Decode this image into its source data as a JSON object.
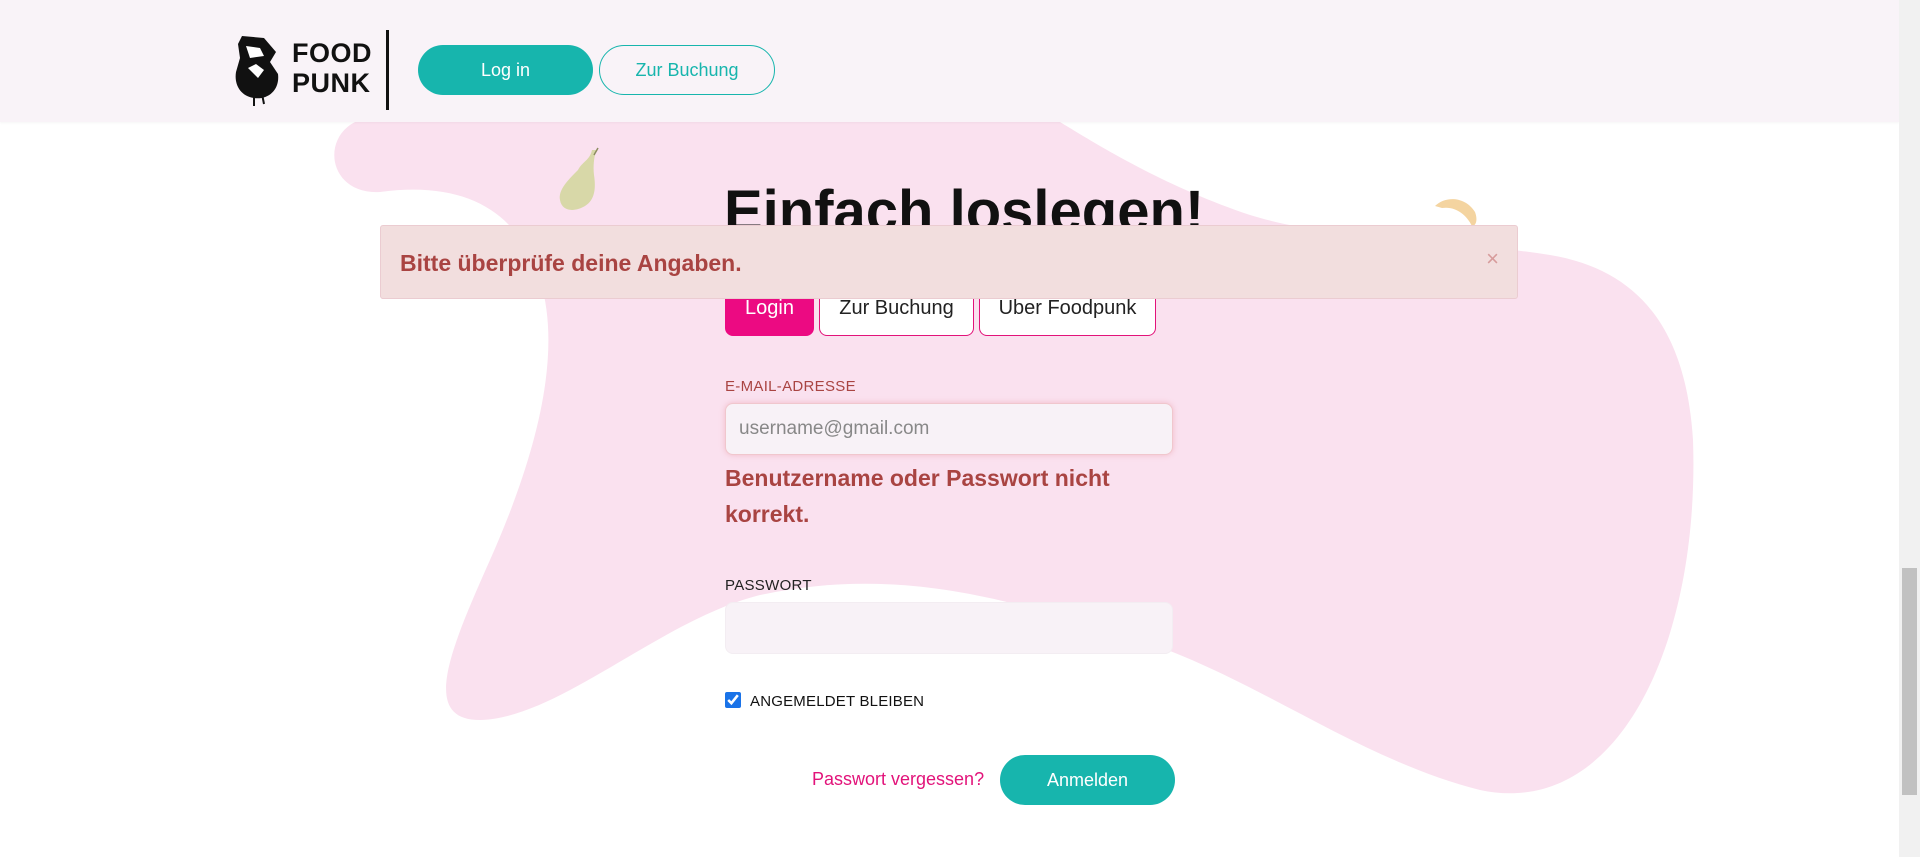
{
  "header": {
    "logo_line1": "FOOD",
    "logo_line2": "PUNK",
    "login_button": "Log in",
    "booking_button": "Zur Buchung"
  },
  "main": {
    "heading": "Einfach loslegen!",
    "tabs": [
      {
        "label": "Login",
        "active": true
      },
      {
        "label": "Zur Buchung",
        "active": false
      },
      {
        "label": "Über Foodpunk",
        "active": false
      }
    ]
  },
  "alert": {
    "message": "Bitte überprüfe deine Angaben.",
    "close_symbol": "×"
  },
  "form": {
    "email_label": "E-MAIL-ADRESSE",
    "email_value": "",
    "email_placeholder": "username@gmail.com",
    "email_error": "Benutzername oder Passwort nicht korrekt.",
    "password_label": "PASSWORT",
    "password_value": "",
    "remember_label": "ANGEMELDET BLEIBEN",
    "remember_checked": true,
    "forgot_link": "Passwort vergessen?",
    "submit_button": "Anmelden"
  },
  "colors": {
    "teal": "#17b5ad",
    "magenta": "#ec0a82",
    "blob": "#fae1ef",
    "error": "#a94442"
  }
}
